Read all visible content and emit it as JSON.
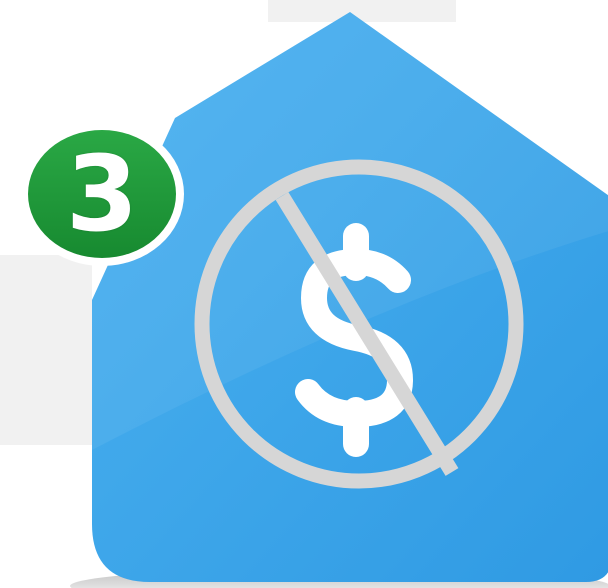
{
  "icon": {
    "name": "house-no-fee-icon",
    "house_color": "#3aa5ea",
    "house_highlight": "#4fb3ef",
    "house_edge": "#2d94dc",
    "prohibition_color": "#d6d6d6",
    "currency_glyph_color": "#ffffff"
  },
  "badge": {
    "count": "3",
    "fill": "#1f9a3a",
    "ring": "#ffffff"
  }
}
